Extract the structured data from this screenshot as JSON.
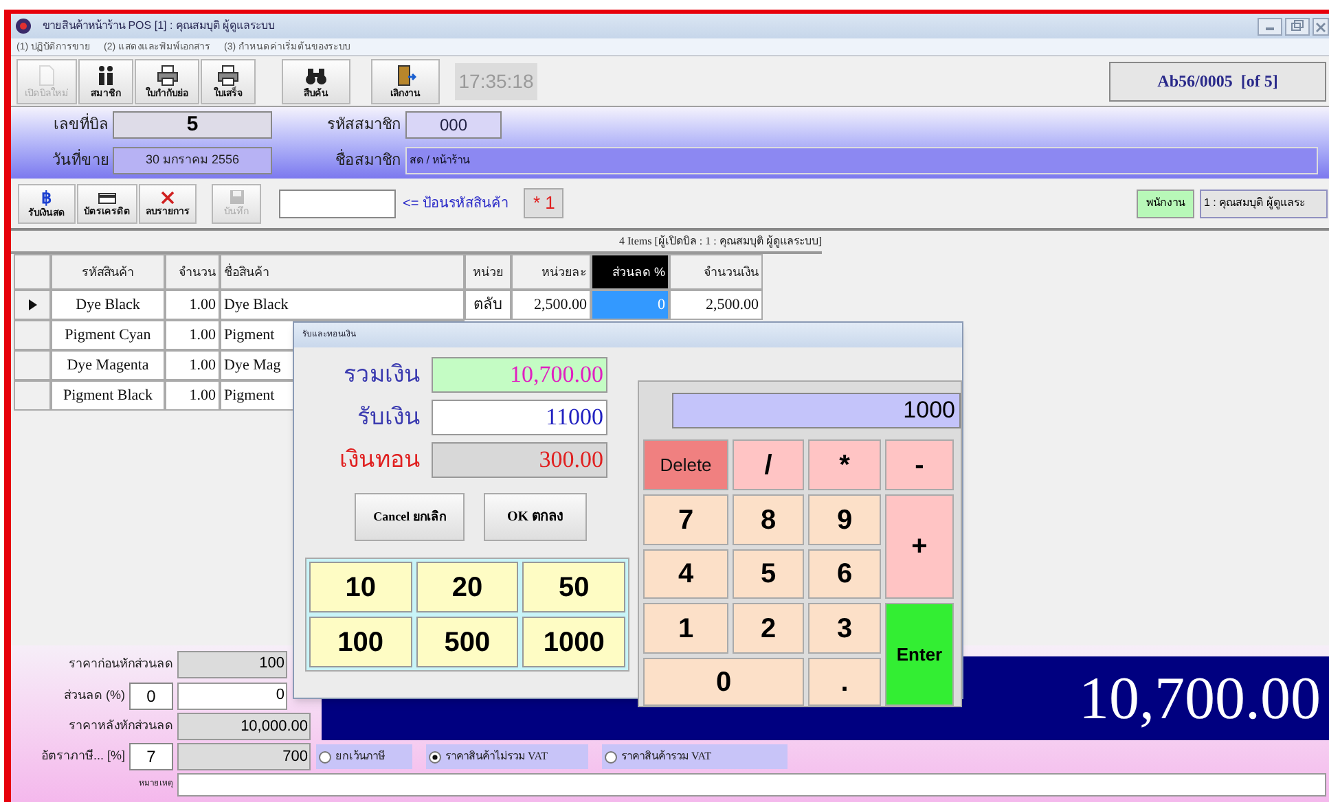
{
  "window": {
    "title": "ขายสินค้าหน้าร้าน POS [1] : คุณสมบุติ ผู้ดูแลระบบ"
  },
  "menu": [
    "(1) ปฏิบัติการขาย",
    "(2) แสดงและพิมพ์เอกสาร",
    "(3) กำหนดค่าเริ่มต้นของระบบ"
  ],
  "toolbar": [
    {
      "label": "เปิดบิลใหม่",
      "disabled": true
    },
    {
      "label": "สมาชิก",
      "disabled": false
    },
    {
      "label": "ใบกำกับย่อ",
      "disabled": false
    },
    {
      "label": "ใบเสร็จ",
      "disabled": false
    },
    {
      "label": "สืบค้น",
      "disabled": false
    },
    {
      "label": "เลิกงาน",
      "disabled": false
    }
  ],
  "clock": "17:35:18",
  "bill_ref": "Ab56/0005  [of 5]",
  "header": {
    "bill_no_label": "เลขที่บิล",
    "bill_no": "5",
    "date_label": "วันที่ขาย",
    "date": "30 มกราคม 2556",
    "member_code_label": "รหัสสมาชิก",
    "member_code": "000",
    "member_name_label": "ชื่อสมาชิก",
    "member_name": "สด / หน้าร้าน"
  },
  "actions": [
    {
      "label": "รับเงินสด",
      "symbol": "฿",
      "disabled": false
    },
    {
      "label": "บัตรเครดิต",
      "disabled": false
    },
    {
      "label": "ลบรายการ",
      "disabled": false
    },
    {
      "label": "บันทึก",
      "disabled": true
    }
  ],
  "product_hint": "<= ป้อนรหัสสินค้า",
  "multiplier": "* 1",
  "staff_label": "พนักงาน",
  "staff": "1 : คุณสมบุติ ผู้ดูแลระ",
  "grid": {
    "summary": "4 Items  [ผู้เปิดบิล : 1 : คุณสมบุติ ผู้ดูแลระบบ]",
    "columns": [
      {
        "label": "รหัสสินค้า",
        "selected": false
      },
      {
        "label": "จำนวน",
        "selected": false
      },
      {
        "label": "ชื่อสินค้า",
        "selected": false
      },
      {
        "label": "หน่วย",
        "selected": false
      },
      {
        "label": "หน่วยละ",
        "selected": false
      },
      {
        "label": "ส่วนลด %",
        "selected": true
      },
      {
        "label": "จำนวนเงิน",
        "selected": false
      }
    ],
    "rows": [
      {
        "selected": true,
        "cells": [
          "Dye Black",
          "1.00",
          "Dye Black",
          "ตลับ",
          "2,500.00",
          "0",
          "2,500.00"
        ]
      },
      {
        "selected": false,
        "cells": [
          "Pigment Cyan",
          "1.00",
          "Pigment"
        ]
      },
      {
        "selected": false,
        "cells": [
          "Dye Magenta",
          "1.00",
          "Dye Mag"
        ]
      },
      {
        "selected": false,
        "cells": [
          "Pigment Black",
          "1.00",
          "Pigment"
        ]
      }
    ]
  },
  "totals": {
    "before_discount_label": "ราคาก่อนหักส่วนลด",
    "before_discount": "100",
    "discount_label": "ส่วนลด (%)",
    "discount_percent": "0",
    "discount": "0",
    "after_discount_label": "ราคาหลังหักส่วนลด",
    "after_discount": "10,000.00",
    "tax_label": "อัตราภาษี... [%]",
    "tax_rate": "7",
    "tax": "700",
    "remark_label": "หมายเหตุ"
  },
  "vat_options": [
    {
      "label": "ยกเว้นภาษี",
      "selected": false
    },
    {
      "label": "ราคาสินค้าไม่รวม VAT",
      "selected": true
    },
    {
      "label": "ราคาสินค้ารวม VAT",
      "selected": false
    }
  ],
  "grand_total": "10,700.00",
  "dialog": {
    "title": "รับและทอนเงิน",
    "total_label": "รวมเงิน",
    "total": "10,700.00",
    "received_label": "รับเงิน",
    "received": "11000",
    "change_label": "เงินทอน",
    "change": "300.00",
    "cancel": "Cancel ยกเลิก",
    "ok": "OK ตกลง",
    "bills": [
      "10",
      "20",
      "50",
      "100",
      "500",
      "1000"
    ],
    "display": "1000",
    "keys": [
      {
        "label": "Delete",
        "kind": "delete"
      },
      {
        "label": "/",
        "kind": "op"
      },
      {
        "label": "*",
        "kind": "op"
      },
      {
        "label": "-",
        "kind": "op"
      },
      {
        "label": "7",
        "kind": "digit"
      },
      {
        "label": "8",
        "kind": "digit"
      },
      {
        "label": "9",
        "kind": "digit"
      },
      {
        "label": "+",
        "kind": "op"
      },
      {
        "label": "4",
        "kind": "digit"
      },
      {
        "label": "5",
        "kind": "digit"
      },
      {
        "label": "6",
        "kind": "digit"
      },
      {
        "label": "1",
        "kind": "digit"
      },
      {
        "label": "2",
        "kind": "digit"
      },
      {
        "label": "3",
        "kind": "digit"
      },
      {
        "label": "Enter",
        "kind": "enter"
      },
      {
        "label": "0",
        "kind": "digit"
      },
      {
        "label": ".",
        "kind": "digit"
      }
    ]
  }
}
